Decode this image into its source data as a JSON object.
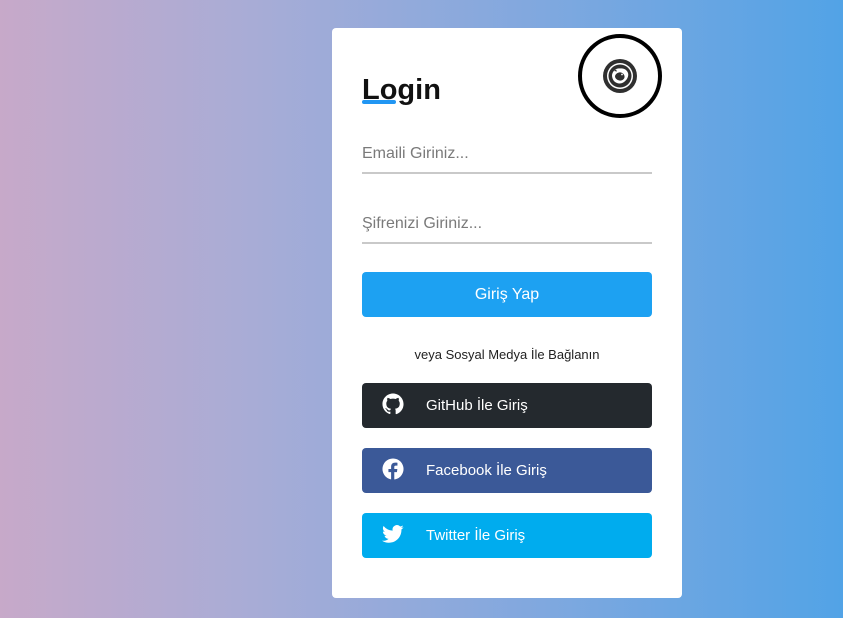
{
  "login_card": {
    "title": "Login",
    "email_placeholder": "Emaili Giriniz...",
    "password_placeholder": "Şifrenizi Giriniz...",
    "login_button": "Giriş Yap",
    "social_prompt": "veya Sosyal Medya İle Bağlanın",
    "social_buttons": [
      {
        "label": "GitHub İle Giriş",
        "icon": "github-icon",
        "color": "#24292e"
      },
      {
        "label": "Facebook İle Giriş",
        "icon": "facebook-icon",
        "color": "#3b5998"
      },
      {
        "label": "Twitter İle Giriş",
        "icon": "twitter-icon",
        "color": "#00acee"
      }
    ],
    "logo_icon": "bear-logo-icon"
  },
  "colors": {
    "primary": "#1da1f2",
    "title_underline": "#2196f3"
  }
}
